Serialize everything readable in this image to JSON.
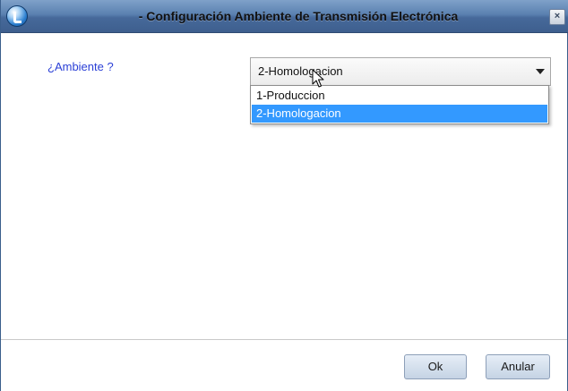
{
  "window": {
    "title": "- Configuración Ambiente de Transmisión Electrónica",
    "close_label": "×"
  },
  "form": {
    "ambiente_label": "¿Ambiente ?",
    "select_value": "2-Homologacion",
    "options": [
      {
        "label": "1-Produccion",
        "selected": false
      },
      {
        "label": "2-Homologacion",
        "selected": true
      }
    ]
  },
  "footer": {
    "ok_label": "Ok",
    "anular_label": "Anular"
  },
  "colors": {
    "titlebar": "#4f74a6",
    "label_blue": "#2a3fd6",
    "selection": "#3399ff"
  }
}
